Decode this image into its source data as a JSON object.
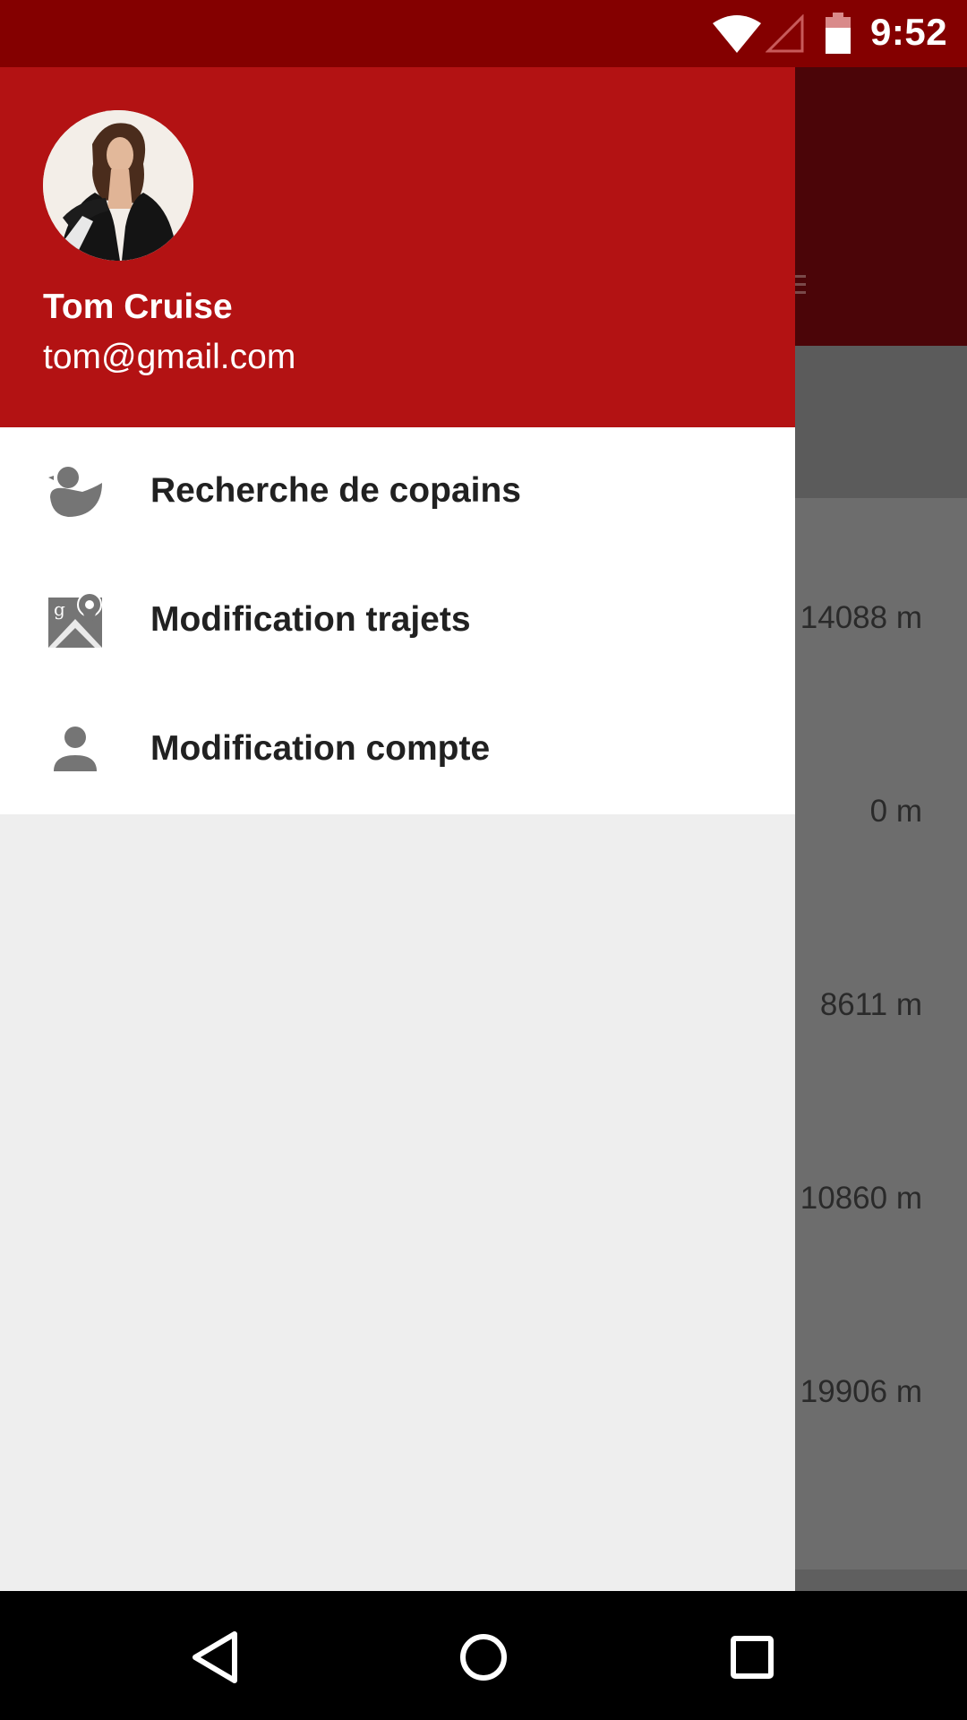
{
  "status_bar": {
    "time": "9:52",
    "icons": [
      "wifi-icon",
      "cell-signal-icon",
      "battery-icon"
    ]
  },
  "drawer": {
    "user": {
      "name": "Tom Cruise",
      "email": "tom@gmail.com",
      "avatar": "profile-photo"
    },
    "menu": [
      {
        "label": "Recherche de copains",
        "icon": "duck-icon"
      },
      {
        "label": "Modification trajets",
        "icon": "google-maps-icon"
      },
      {
        "label": "Modification compte",
        "icon": "person-icon"
      }
    ]
  },
  "background_list": {
    "distances": [
      "14088 m",
      "0 m",
      "8611 m",
      "10860 m",
      "19906 m"
    ]
  },
  "nav_bar": {
    "buttons": [
      "back-icon",
      "home-icon",
      "recents-icon"
    ]
  },
  "colors": {
    "status_bar": "#840000",
    "drawer_header": "#b31213",
    "toolbar_dimmed": "#4b0508",
    "drawer_body": "#eeeeee",
    "menu_icon": "#757575",
    "menu_text": "#212121"
  }
}
